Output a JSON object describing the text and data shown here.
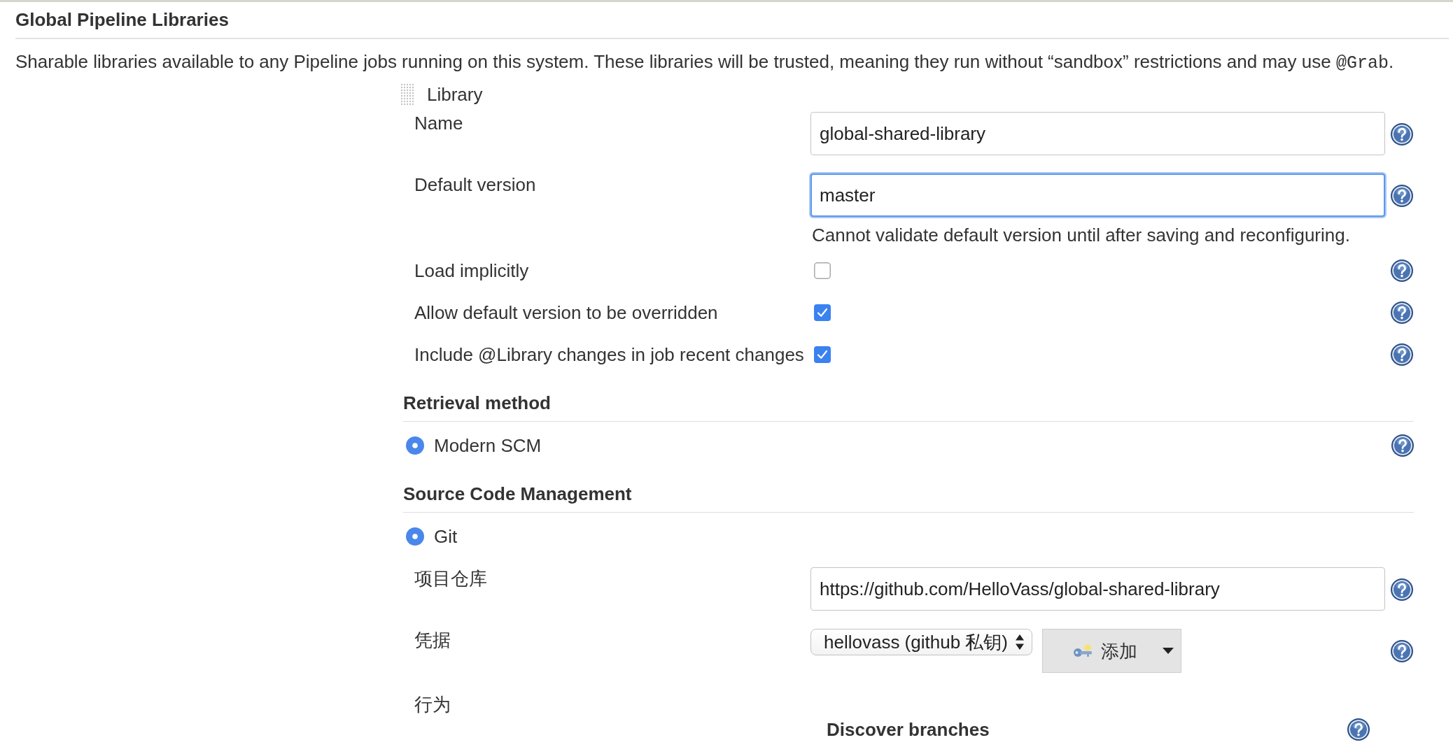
{
  "section": {
    "title": "Global Pipeline Libraries",
    "description": "Sharable libraries available to any Pipeline jobs running on this system. These libraries will be trusted, meaning they run without “sandbox” restrictions and may use ",
    "description_code": "@Grab",
    "description_end": "."
  },
  "library": {
    "label": "Library",
    "fields": [
      {
        "kind": "text",
        "label": "Name",
        "value": "global-shared-library",
        "focused": false
      },
      {
        "kind": "text",
        "label": "Default version",
        "value": "master",
        "focused": true,
        "note": "Cannot validate default version until after saving and reconfiguring."
      },
      {
        "kind": "checkbox",
        "label": "Load implicitly",
        "checked": false
      },
      {
        "kind": "checkbox",
        "label": "Allow default version to be overridden",
        "checked": true
      },
      {
        "kind": "checkbox",
        "label": "Include @Library changes in job recent changes",
        "checked": true
      }
    ],
    "retrieval_method": {
      "title": "Retrieval method",
      "options": [
        {
          "label": "Modern SCM",
          "selected": true,
          "help": true
        }
      ]
    },
    "source_code_management": {
      "title": "Source Code Management",
      "options": [
        {
          "label": "Git",
          "selected": true,
          "help": false
        }
      ],
      "fields": [
        {
          "kind": "text",
          "label": "项目仓库",
          "value": "https://github.com/HelloVass/global-shared-library",
          "focused": false
        },
        {
          "kind": "select",
          "label": "凭据",
          "value": "hellovass (github 私钥)",
          "add_button": "添加"
        },
        {
          "kind": "behaviours",
          "label": "行为",
          "items": [
            {
              "title": "Discover branches"
            }
          ]
        }
      ]
    }
  }
}
